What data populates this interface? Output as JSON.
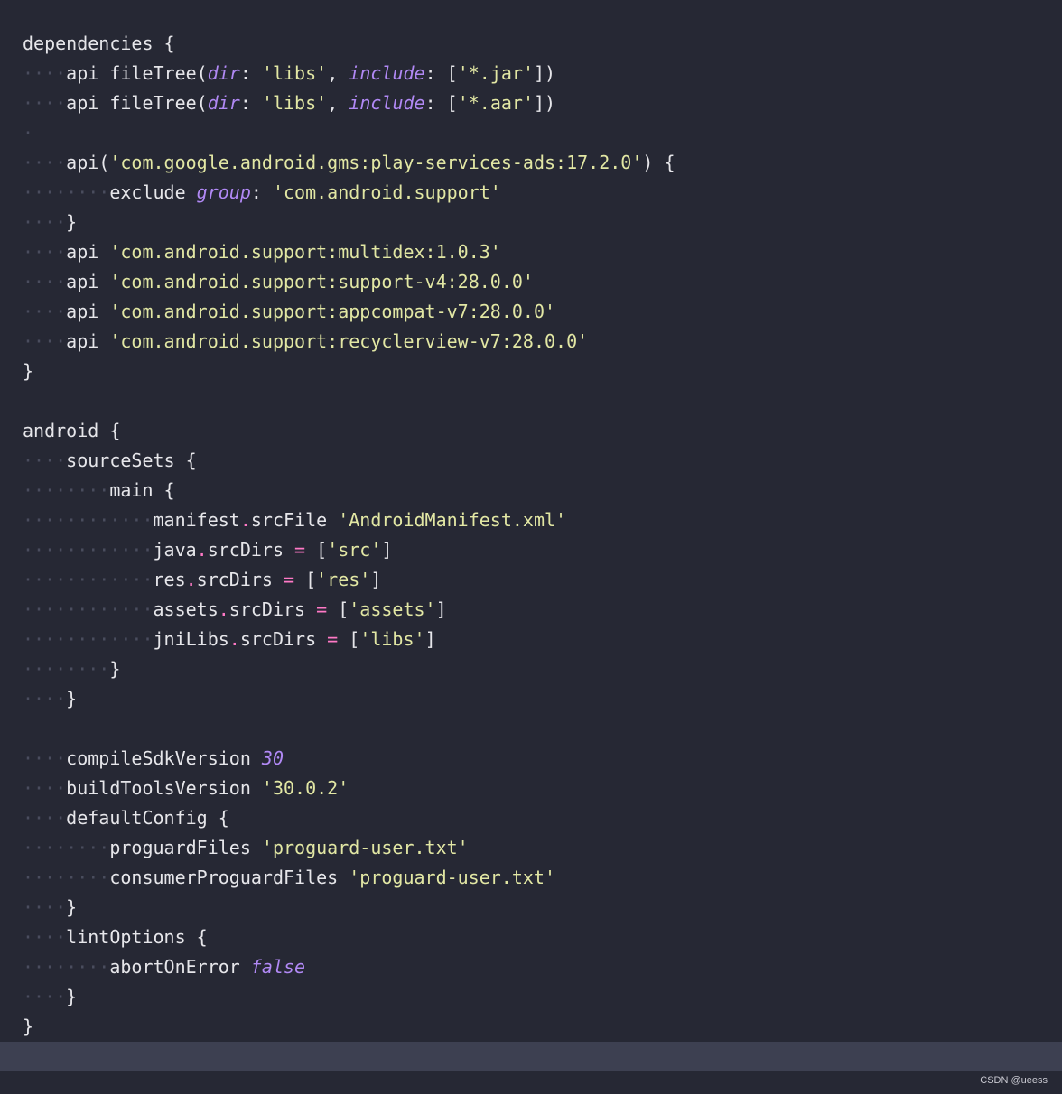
{
  "watermark": "CSDN @ueess",
  "colors": {
    "background": "#262834",
    "text": "#e6e6ea",
    "string": "#e2e7a4",
    "param": "#b189f5",
    "operator": "#ff79c6",
    "whitespace": "#4a4d5e",
    "caret_row": "#3d4051"
  },
  "lines": [
    {
      "indent": 0,
      "tokens": [
        {
          "t": "dependencies {",
          "c": "txt"
        }
      ]
    },
    {
      "indent": 1,
      "tokens": [
        {
          "t": "api fileTree(",
          "c": "txt"
        },
        {
          "t": "dir",
          "c": "par"
        },
        {
          "t": ": ",
          "c": "txt"
        },
        {
          "t": "'libs'",
          "c": "str"
        },
        {
          "t": ", ",
          "c": "txt"
        },
        {
          "t": "include",
          "c": "par"
        },
        {
          "t": ": [",
          "c": "txt"
        },
        {
          "t": "'*.jar'",
          "c": "str"
        },
        {
          "t": "])",
          "c": "txt"
        }
      ]
    },
    {
      "indent": 1,
      "tokens": [
        {
          "t": "api fileTree(",
          "c": "txt"
        },
        {
          "t": "dir",
          "c": "par"
        },
        {
          "t": ": ",
          "c": "txt"
        },
        {
          "t": "'libs'",
          "c": "str"
        },
        {
          "t": ", ",
          "c": "txt"
        },
        {
          "t": "include",
          "c": "par"
        },
        {
          "t": ": [",
          "c": "txt"
        },
        {
          "t": "'*.aar'",
          "c": "str"
        },
        {
          "t": "])",
          "c": "txt"
        }
      ]
    },
    {
      "indent": 0,
      "blankdot": true,
      "tokens": []
    },
    {
      "indent": 1,
      "tokens": [
        {
          "t": "api(",
          "c": "txt"
        },
        {
          "t": "'com.google.android.gms:play-services-ads:17.2.0'",
          "c": "str"
        },
        {
          "t": ") {",
          "c": "txt"
        }
      ]
    },
    {
      "indent": 2,
      "tokens": [
        {
          "t": "exclude ",
          "c": "txt"
        },
        {
          "t": "group",
          "c": "par"
        },
        {
          "t": ": ",
          "c": "txt"
        },
        {
          "t": "'com.android.support'",
          "c": "str"
        }
      ]
    },
    {
      "indent": 1,
      "tokens": [
        {
          "t": "}",
          "c": "txt"
        }
      ]
    },
    {
      "indent": 1,
      "tokens": [
        {
          "t": "api ",
          "c": "txt"
        },
        {
          "t": "'com.android.support:multidex:1.0.3'",
          "c": "str"
        }
      ]
    },
    {
      "indent": 1,
      "tokens": [
        {
          "t": "api ",
          "c": "txt"
        },
        {
          "t": "'com.android.support:support-v4:28.0.0'",
          "c": "str"
        }
      ]
    },
    {
      "indent": 1,
      "tokens": [
        {
          "t": "api ",
          "c": "txt"
        },
        {
          "t": "'com.android.support:appcompat-v7:28.0.0'",
          "c": "str"
        }
      ]
    },
    {
      "indent": 1,
      "tokens": [
        {
          "t": "api ",
          "c": "txt"
        },
        {
          "t": "'com.android.support:recyclerview-v7:28.0.0'",
          "c": "str"
        }
      ]
    },
    {
      "indent": 0,
      "tokens": [
        {
          "t": "}",
          "c": "txt"
        }
      ]
    },
    {
      "indent": 0,
      "tokens": []
    },
    {
      "indent": 0,
      "tokens": [
        {
          "t": "android {",
          "c": "txt"
        }
      ]
    },
    {
      "indent": 1,
      "tokens": [
        {
          "t": "sourceSets {",
          "c": "txt"
        }
      ]
    },
    {
      "indent": 2,
      "tokens": [
        {
          "t": "main {",
          "c": "txt"
        }
      ]
    },
    {
      "indent": 3,
      "tokens": [
        {
          "t": "manifest",
          "c": "txt"
        },
        {
          "t": ".",
          "c": "op"
        },
        {
          "t": "srcFile ",
          "c": "txt"
        },
        {
          "t": "'AndroidManifest.xml'",
          "c": "str"
        }
      ]
    },
    {
      "indent": 3,
      "tokens": [
        {
          "t": "java",
          "c": "txt"
        },
        {
          "t": ".",
          "c": "op"
        },
        {
          "t": "srcDirs ",
          "c": "txt"
        },
        {
          "t": "=",
          "c": "op"
        },
        {
          "t": " [",
          "c": "txt"
        },
        {
          "t": "'src'",
          "c": "str"
        },
        {
          "t": "]",
          "c": "txt"
        }
      ]
    },
    {
      "indent": 3,
      "tokens": [
        {
          "t": "res",
          "c": "txt"
        },
        {
          "t": ".",
          "c": "op"
        },
        {
          "t": "srcDirs ",
          "c": "txt"
        },
        {
          "t": "=",
          "c": "op"
        },
        {
          "t": " [",
          "c": "txt"
        },
        {
          "t": "'res'",
          "c": "str"
        },
        {
          "t": "]",
          "c": "txt"
        }
      ]
    },
    {
      "indent": 3,
      "tokens": [
        {
          "t": "assets",
          "c": "txt"
        },
        {
          "t": ".",
          "c": "op"
        },
        {
          "t": "srcDirs ",
          "c": "txt"
        },
        {
          "t": "=",
          "c": "op"
        },
        {
          "t": " [",
          "c": "txt"
        },
        {
          "t": "'assets'",
          "c": "str"
        },
        {
          "t": "]",
          "c": "txt"
        }
      ]
    },
    {
      "indent": 3,
      "tokens": [
        {
          "t": "jniLibs",
          "c": "txt"
        },
        {
          "t": ".",
          "c": "op"
        },
        {
          "t": "srcDirs ",
          "c": "txt"
        },
        {
          "t": "=",
          "c": "op"
        },
        {
          "t": " [",
          "c": "txt"
        },
        {
          "t": "'libs'",
          "c": "str"
        },
        {
          "t": "]",
          "c": "txt"
        }
      ]
    },
    {
      "indent": 2,
      "tokens": [
        {
          "t": "}",
          "c": "txt"
        }
      ]
    },
    {
      "indent": 1,
      "tokens": [
        {
          "t": "}",
          "c": "txt"
        }
      ]
    },
    {
      "indent": 0,
      "tokens": []
    },
    {
      "indent": 1,
      "tokens": [
        {
          "t": "compileSdkVersion ",
          "c": "txt"
        },
        {
          "t": "30",
          "c": "num"
        }
      ]
    },
    {
      "indent": 1,
      "tokens": [
        {
          "t": "buildToolsVersion ",
          "c": "txt"
        },
        {
          "t": "'30.0.2'",
          "c": "str"
        }
      ]
    },
    {
      "indent": 1,
      "tokens": [
        {
          "t": "defaultConfig {",
          "c": "txt"
        }
      ]
    },
    {
      "indent": 2,
      "tokens": [
        {
          "t": "proguardFiles ",
          "c": "txt"
        },
        {
          "t": "'proguard-user.txt'",
          "c": "str"
        }
      ]
    },
    {
      "indent": 2,
      "tokens": [
        {
          "t": "consumerProguardFiles ",
          "c": "txt"
        },
        {
          "t": "'proguard-user.txt'",
          "c": "str"
        }
      ]
    },
    {
      "indent": 1,
      "tokens": [
        {
          "t": "}",
          "c": "txt"
        }
      ]
    },
    {
      "indent": 1,
      "tokens": [
        {
          "t": "lintOptions {",
          "c": "txt"
        }
      ]
    },
    {
      "indent": 2,
      "tokens": [
        {
          "t": "abortOnError ",
          "c": "txt"
        },
        {
          "t": "false",
          "c": "kw"
        }
      ]
    },
    {
      "indent": 1,
      "tokens": [
        {
          "t": "}",
          "c": "txt"
        }
      ]
    },
    {
      "indent": 0,
      "tokens": [
        {
          "t": "}",
          "c": "txt"
        }
      ]
    },
    {
      "indent": 0,
      "tokens": []
    }
  ]
}
